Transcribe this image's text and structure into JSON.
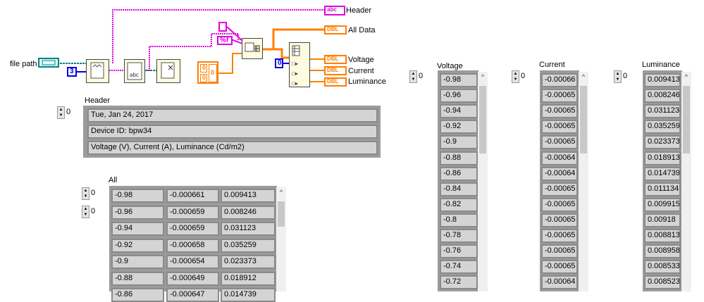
{
  "diagram": {
    "file_path_label": "file path",
    "header_terminal_label": "Header",
    "all_data_label": "All Data",
    "voltage_label": "Voltage",
    "current_label": "Current",
    "luminance_label": "Luminance",
    "const_three": "3",
    "const_zero": "0",
    "format_string": "%f",
    "empty_str": " ",
    "abc_tag": "abc",
    "dbl_tag": "DBL"
  },
  "header_panel": {
    "label": "Header",
    "index": "0",
    "rows": [
      "Tue, Jan 24, 2017",
      "Device ID: bpw34",
      "Voltage (V), Current (A), Luminance (Cd/m2)"
    ]
  },
  "all_panel": {
    "label": "All",
    "row_index": "0",
    "col_index": "0",
    "rows": [
      [
        "-0.98",
        "-0.000661",
        "0.009413"
      ],
      [
        "-0.96",
        "-0.000659",
        "0.008246"
      ],
      [
        "-0.94",
        "-0.000659",
        "0.031123"
      ],
      [
        "-0.92",
        "-0.000658",
        "0.035259"
      ],
      [
        "-0.9",
        "-0.000654",
        "0.023373"
      ],
      [
        "-0.88",
        "-0.000649",
        "0.018912"
      ],
      [
        "-0.86",
        "-0.000647",
        "0.014739"
      ]
    ]
  },
  "voltage_panel": {
    "label": "Voltage",
    "index": "0",
    "values": [
      "-0.98",
      "-0.96",
      "-0.94",
      "-0.92",
      "-0.9",
      "-0.88",
      "-0.86",
      "-0.84",
      "-0.82",
      "-0.8",
      "-0.78",
      "-0.76",
      "-0.74",
      "-0.72"
    ]
  },
  "current_panel": {
    "label": "Current",
    "index": "0",
    "values": [
      "-0.00066",
      "-0.00065",
      "-0.00065",
      "-0.00065",
      "-0.00065",
      "-0.00064",
      "-0.00064",
      "-0.00065",
      "-0.00065",
      "-0.00065",
      "-0.00065",
      "-0.00065",
      "-0.00065",
      "-0.00064"
    ]
  },
  "luminance_panel": {
    "label": "Luminance",
    "index": "0",
    "values": [
      "0.009413",
      "0.008246",
      "0.031123",
      "0.035259",
      "0.023373",
      "0.018913",
      "0.014739",
      "0.011134",
      "0.009915",
      "0.00918",
      "0.008813",
      "0.008958",
      "0.008533",
      "0.008523"
    ]
  },
  "colors": {
    "string_wire": "#e000e0",
    "dbl_wire": "#ff7f00",
    "path_wire": "#008080",
    "int_wire": "#0000e0"
  }
}
